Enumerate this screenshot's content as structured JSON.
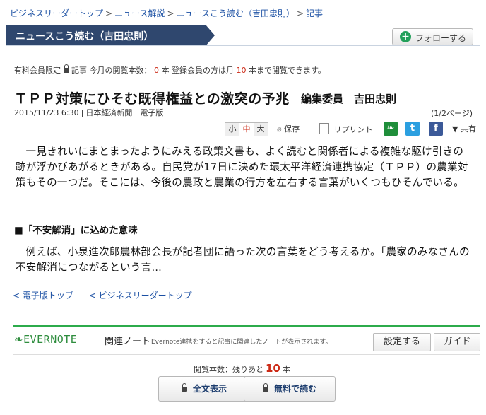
{
  "breadcrumb": {
    "items": [
      "ビジネスリーダートップ",
      "ニュース解説",
      "ニュースこう読む（吉田忠則）",
      "記事"
    ],
    "separator": ">"
  },
  "section": {
    "title": "ニュースこう読む（吉田忠則）",
    "follow_label": "フォローする"
  },
  "membership": {
    "prefix": "有料会員限定",
    "label": "記事",
    "count_text": "今月の閲覧本数：",
    "count": "0",
    "unit": "本",
    "registered_text": "登録会員の方は月",
    "limit": "10",
    "suffix": "本まで閲覧できます。"
  },
  "article": {
    "title": "ＴＰＰ対策にひそむ既得権益との激突の予兆",
    "byline": "編集委員　吉田忠則",
    "date": "2015/11/23 6:30",
    "source": "日本経済新聞　電子版",
    "page": "(1/2ページ)",
    "paragraphs": [
      "一見きれいにまとまったようにみえる政策文書も、よく読むと関係者による複雑な駆け引きの跡が浮かびあがるときがある。自民党が17日に決めた環太平洋経済連携協定（ＴＰＰ）の農業対策もその一つだ。そこには、今後の農政と農業の行方を左右する言葉がいくつもひそんでいる。",
      "例えば、小泉進次郎農林部会長が記者団に語った次の言葉をどう考えるか。「農家のみなさんの不安解消につながるという言…"
    ],
    "subheading": "■「不安解消」に込めた意味"
  },
  "tools": {
    "font_sizes": [
      "小",
      "中",
      "大"
    ],
    "save": "保存",
    "reprint": "リプリント",
    "share": "▼ 共有",
    "icons": {
      "save": "paperclip-icon",
      "reprint": "document-icon",
      "evernote": "evernote-icon",
      "twitter": "twitter-icon",
      "facebook": "facebook-icon"
    }
  },
  "back_links": [
    "< 電子版トップ",
    "< ビジネスリーダートップ"
  ],
  "evernote": {
    "logo": "EVERNOTE",
    "title": "関連ノート",
    "note": "Evernote連携をすると記事に関連したノートが表示されます。",
    "settings_label": "設定する",
    "guide_label": "ガイド"
  },
  "remaining": {
    "prefix": "閲覧本数：残りあと",
    "count": "10",
    "unit": "本"
  },
  "cta": {
    "full_text": "全文表示",
    "free_reg": "無料で読む"
  },
  "colors": {
    "banner": "#2f476e",
    "accent_red": "#cc2a16",
    "link": "#1a4fa3",
    "evernote_green": "#2cab4b"
  }
}
